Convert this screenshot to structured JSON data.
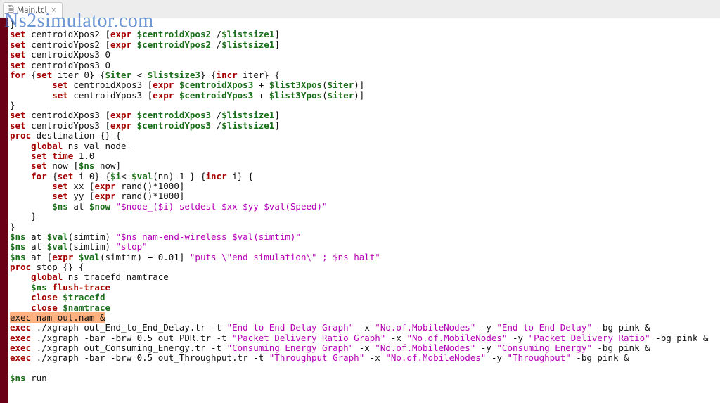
{
  "tab": {
    "filename": "Main.tcl",
    "close": "×"
  },
  "watermark": "Ns2simulator.com",
  "code_lines": [
    [
      [
        "id",
        "}"
      ]
    ],
    [
      [
        "kw",
        "set"
      ],
      [
        "id",
        " centroidXpos2 ["
      ],
      [
        "kw",
        "expr"
      ],
      [
        "id",
        " "
      ],
      [
        "var",
        "$centroidXpos2"
      ],
      [
        "id",
        " /"
      ],
      [
        "var",
        "$listsize1"
      ],
      [
        "id",
        "]"
      ]
    ],
    [
      [
        "kw",
        "set"
      ],
      [
        "id",
        " centroidYpos2 ["
      ],
      [
        "kw",
        "expr"
      ],
      [
        "id",
        " "
      ],
      [
        "var",
        "$centroidYpos2"
      ],
      [
        "id",
        " /"
      ],
      [
        "var",
        "$listsize1"
      ],
      [
        "id",
        "]"
      ]
    ],
    [
      [
        "kw",
        "set"
      ],
      [
        "id",
        " centroidXpos3 0"
      ]
    ],
    [
      [
        "kw",
        "set"
      ],
      [
        "id",
        " centroidYpos3 0"
      ]
    ],
    [
      [
        "kw",
        "for"
      ],
      [
        "id",
        " {"
      ],
      [
        "kw",
        "set"
      ],
      [
        "id",
        " iter 0} {"
      ],
      [
        "var",
        "$iter"
      ],
      [
        "id",
        " < "
      ],
      [
        "var",
        "$listsize3"
      ],
      [
        "id",
        "} {"
      ],
      [
        "kw",
        "incr"
      ],
      [
        "id",
        " iter} {"
      ]
    ],
    [
      [
        "id",
        "        "
      ],
      [
        "kw",
        "set"
      ],
      [
        "id",
        " centroidXpos3 ["
      ],
      [
        "kw",
        "expr"
      ],
      [
        "id",
        " "
      ],
      [
        "var",
        "$centroidXpos3"
      ],
      [
        "id",
        " + "
      ],
      [
        "var",
        "$list3Xpos"
      ],
      [
        "id",
        "("
      ],
      [
        "var",
        "$iter"
      ],
      [
        "id",
        ")]"
      ]
    ],
    [
      [
        "id",
        "        "
      ],
      [
        "kw",
        "set"
      ],
      [
        "id",
        " centroidYpos3 ["
      ],
      [
        "kw",
        "expr"
      ],
      [
        "id",
        " "
      ],
      [
        "var",
        "$centroidYpos3"
      ],
      [
        "id",
        " + "
      ],
      [
        "var",
        "$list3Ypos"
      ],
      [
        "id",
        "("
      ],
      [
        "var",
        "$iter"
      ],
      [
        "id",
        ")]"
      ]
    ],
    [
      [
        "id",
        "}"
      ]
    ],
    [
      [
        "kw",
        "set"
      ],
      [
        "id",
        " centroidXpos3 ["
      ],
      [
        "kw",
        "expr"
      ],
      [
        "id",
        " "
      ],
      [
        "var",
        "$centroidXpos3"
      ],
      [
        "id",
        " /"
      ],
      [
        "var",
        "$listsize1"
      ],
      [
        "id",
        "]"
      ]
    ],
    [
      [
        "kw",
        "set"
      ],
      [
        "id",
        " centroidYpos3 ["
      ],
      [
        "kw",
        "expr"
      ],
      [
        "id",
        " "
      ],
      [
        "var",
        "$centroidYpos3"
      ],
      [
        "id",
        " /"
      ],
      [
        "var",
        "$listsize1"
      ],
      [
        "id",
        "]"
      ]
    ],
    [
      [
        "kw",
        "proc"
      ],
      [
        "id",
        " destination {} {"
      ]
    ],
    [
      [
        "id",
        "    "
      ],
      [
        "kw",
        "global"
      ],
      [
        "id",
        " ns val node_"
      ]
    ],
    [
      [
        "id",
        "    "
      ],
      [
        "kw",
        "set"
      ],
      [
        "id",
        " "
      ],
      [
        "cmd",
        "time"
      ],
      [
        "id",
        " 1.0"
      ]
    ],
    [
      [
        "id",
        "    "
      ],
      [
        "kw",
        "set"
      ],
      [
        "id",
        " now ["
      ],
      [
        "var",
        "$ns"
      ],
      [
        "id",
        " now]"
      ]
    ],
    [
      [
        "id",
        "    "
      ],
      [
        "kw",
        "for"
      ],
      [
        "id",
        " {"
      ],
      [
        "kw",
        "set"
      ],
      [
        "id",
        " i 0} {"
      ],
      [
        "var",
        "$i"
      ],
      [
        "id",
        "< "
      ],
      [
        "var",
        "$val"
      ],
      [
        "id",
        "(nn)-1 } {"
      ],
      [
        "kw",
        "incr"
      ],
      [
        "id",
        " i} {"
      ]
    ],
    [
      [
        "id",
        "        "
      ],
      [
        "kw",
        "set"
      ],
      [
        "id",
        " xx ["
      ],
      [
        "kw",
        "expr"
      ],
      [
        "id",
        " rand()*1000]"
      ]
    ],
    [
      [
        "id",
        "        "
      ],
      [
        "kw",
        "set"
      ],
      [
        "id",
        " yy ["
      ],
      [
        "kw",
        "expr"
      ],
      [
        "id",
        " rand()*1000]"
      ]
    ],
    [
      [
        "id",
        "        "
      ],
      [
        "var",
        "$ns"
      ],
      [
        "id",
        " at "
      ],
      [
        "var",
        "$now"
      ],
      [
        "id",
        " "
      ],
      [
        "str",
        "\"$node_($i) setdest $xx $yy $val(Speed)\""
      ]
    ],
    [
      [
        "id",
        "    }"
      ]
    ],
    [
      [
        "id",
        "}"
      ]
    ],
    [
      [
        "var",
        "$ns"
      ],
      [
        "id",
        " at "
      ],
      [
        "var",
        "$val"
      ],
      [
        "id",
        "(simtim) "
      ],
      [
        "str",
        "\"$ns nam-end-wireless $val(simtim)\""
      ]
    ],
    [
      [
        "var",
        "$ns"
      ],
      [
        "id",
        " at "
      ],
      [
        "var",
        "$val"
      ],
      [
        "id",
        "(simtim) "
      ],
      [
        "str",
        "\"stop\""
      ]
    ],
    [
      [
        "var",
        "$ns"
      ],
      [
        "id",
        " at ["
      ],
      [
        "kw",
        "expr"
      ],
      [
        "id",
        " "
      ],
      [
        "var",
        "$val"
      ],
      [
        "id",
        "(simtim) + 0.01] "
      ],
      [
        "str",
        "\"puts \\\"end simulation\\\" ; $ns halt\""
      ]
    ],
    [
      [
        "kw",
        "proc"
      ],
      [
        "id",
        " stop {} {"
      ]
    ],
    [
      [
        "id",
        "    "
      ],
      [
        "kw",
        "global"
      ],
      [
        "id",
        " ns tracefd namtrace"
      ]
    ],
    [
      [
        "id",
        "    "
      ],
      [
        "var",
        "$ns"
      ],
      [
        "id",
        " "
      ],
      [
        "cmd",
        "flush-trace"
      ]
    ],
    [
      [
        "id",
        "    "
      ],
      [
        "kw",
        "close"
      ],
      [
        "id",
        " "
      ],
      [
        "var",
        "$tracefd"
      ]
    ],
    [
      [
        "id",
        "    "
      ],
      [
        "kw",
        "close"
      ],
      [
        "id",
        " "
      ],
      [
        "var",
        "$namtrace"
      ]
    ],
    [
      [
        "hl",
        "exec nam out.nam &"
      ]
    ],
    [
      [
        "kw",
        "exec"
      ],
      [
        "id",
        " ./xgraph out_End_to_End_Delay.tr -t "
      ],
      [
        "str",
        "\"End to End Delay Graph\""
      ],
      [
        "id",
        " -x "
      ],
      [
        "str",
        "\"No.of.MobileNodes\""
      ],
      [
        "id",
        " -y "
      ],
      [
        "str",
        "\"End to End Delay\""
      ],
      [
        "id",
        " -bg pink &"
      ]
    ],
    [
      [
        "kw",
        "exec"
      ],
      [
        "id",
        " ./xgraph -bar -brw 0.5 out_PDR.tr -t "
      ],
      [
        "str",
        "\"Packet Delivery Ratio Graph\""
      ],
      [
        "id",
        " -x "
      ],
      [
        "str",
        "\"No.of.MobileNodes\""
      ],
      [
        "id",
        " -y "
      ],
      [
        "str",
        "\"Packet Delivery Ratio\""
      ],
      [
        "id",
        " -bg pink &"
      ]
    ],
    [
      [
        "kw",
        "exec"
      ],
      [
        "id",
        " ./xgraph out_Consuming_Energy.tr -t "
      ],
      [
        "str",
        "\"Consuming Energy Graph\""
      ],
      [
        "id",
        " -x "
      ],
      [
        "str",
        "\"No.of.MobileNodes\""
      ],
      [
        "id",
        " -y "
      ],
      [
        "str",
        "\"Consuming Energy\""
      ],
      [
        "id",
        " -bg pink &"
      ]
    ],
    [
      [
        "kw",
        "exec"
      ],
      [
        "id",
        " ./xgraph -bar -brw 0.5 out_Throughput.tr -t "
      ],
      [
        "str",
        "\"Throughput Graph\""
      ],
      [
        "id",
        " -x "
      ],
      [
        "str",
        "\"No.of.MobileNodes\""
      ],
      [
        "id",
        " -y "
      ],
      [
        "str",
        "\"Throughput\""
      ],
      [
        "id",
        " -bg pink &"
      ]
    ],
    [
      [
        "id",
        " "
      ]
    ],
    [
      [
        "var",
        "$ns"
      ],
      [
        "id",
        " run"
      ]
    ]
  ]
}
